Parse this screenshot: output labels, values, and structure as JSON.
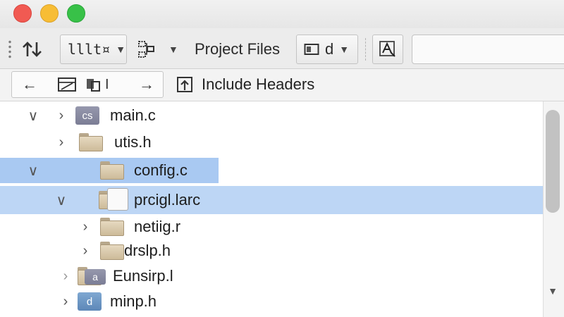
{
  "toolbar": {
    "scheme_label": "lllt¤",
    "project_files_label": "Project Files",
    "layout_label": "d",
    "icons": {
      "grip": "drag-handle-icon",
      "sort": "sort-arrows-icon",
      "scheme": "scheme-icon",
      "hierarchy": "hierarchy-icon",
      "layout": "window-layout-icon",
      "font": "font-icon"
    },
    "search_value": ""
  },
  "navbar": {
    "back": "←",
    "forward": "→",
    "mid_label": "I",
    "include_headers": "Include Headers"
  },
  "tree": {
    "rows": [
      {
        "label": "main.c",
        "icon_text": "cs"
      },
      {
        "label": "utis.h"
      },
      {
        "label": "config.c"
      },
      {
        "label": "prcigl.larc"
      },
      {
        "label": "netiig.r"
      },
      {
        "label": "drslp.h"
      },
      {
        "label": "Eunsirp.l",
        "icon_text": "a"
      },
      {
        "label": "minp.h",
        "icon_text": "d"
      }
    ]
  },
  "colors": {
    "selection": "#a9c9f2",
    "selection_row": "#bdd6f5",
    "close": "#f15a52",
    "minimize": "#f7bd35",
    "zoom": "#38c148"
  }
}
